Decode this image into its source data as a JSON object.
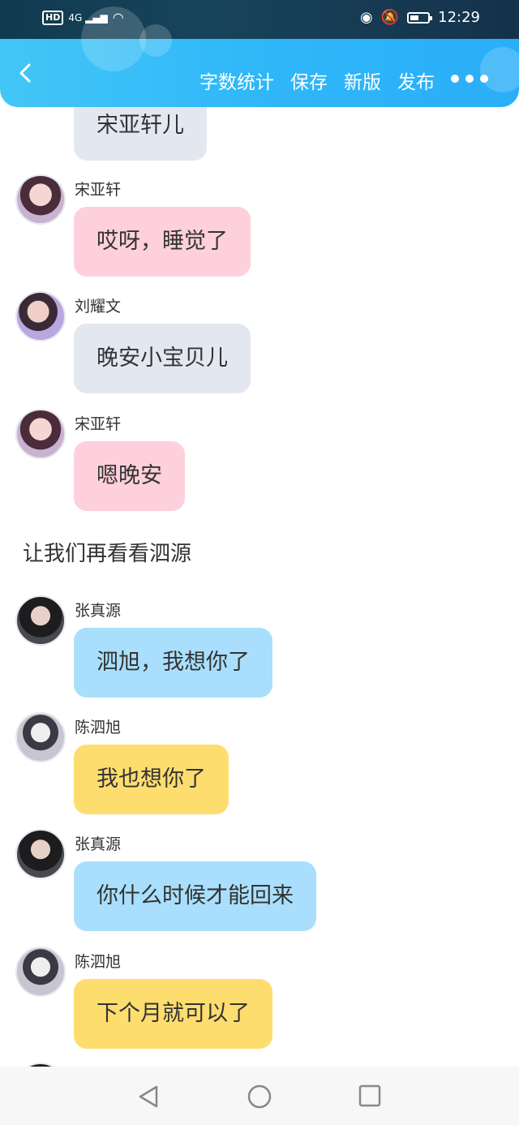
{
  "status_bar": {
    "network": "HD",
    "signal": "4G",
    "time": "12:29"
  },
  "top_bar": {
    "actions": [
      "字数统计",
      "保存",
      "新版",
      "发布"
    ],
    "accent": "#2fb7f8"
  },
  "messages": [
    {
      "name": "",
      "text": "宋亚轩儿",
      "color": "gray"
    },
    {
      "name": "宋亚轩",
      "text": "哎呀，睡觉了",
      "color": "pink"
    },
    {
      "name": "刘耀文",
      "text": "晚安小宝贝儿",
      "color": "gray"
    },
    {
      "name": "宋亚轩",
      "text": "嗯晚安",
      "color": "pink"
    },
    {
      "narration": "让我们再看看泗源"
    },
    {
      "name": "张真源",
      "text": "泗旭，我想你了",
      "color": "blue"
    },
    {
      "name": "陈泗旭",
      "text": "我也想你了",
      "color": "yellow"
    },
    {
      "name": "张真源",
      "text": "你什么时候才能回来",
      "color": "blue"
    },
    {
      "name": "陈泗旭",
      "text": "下个月就可以了",
      "color": "yellow"
    }
  ]
}
